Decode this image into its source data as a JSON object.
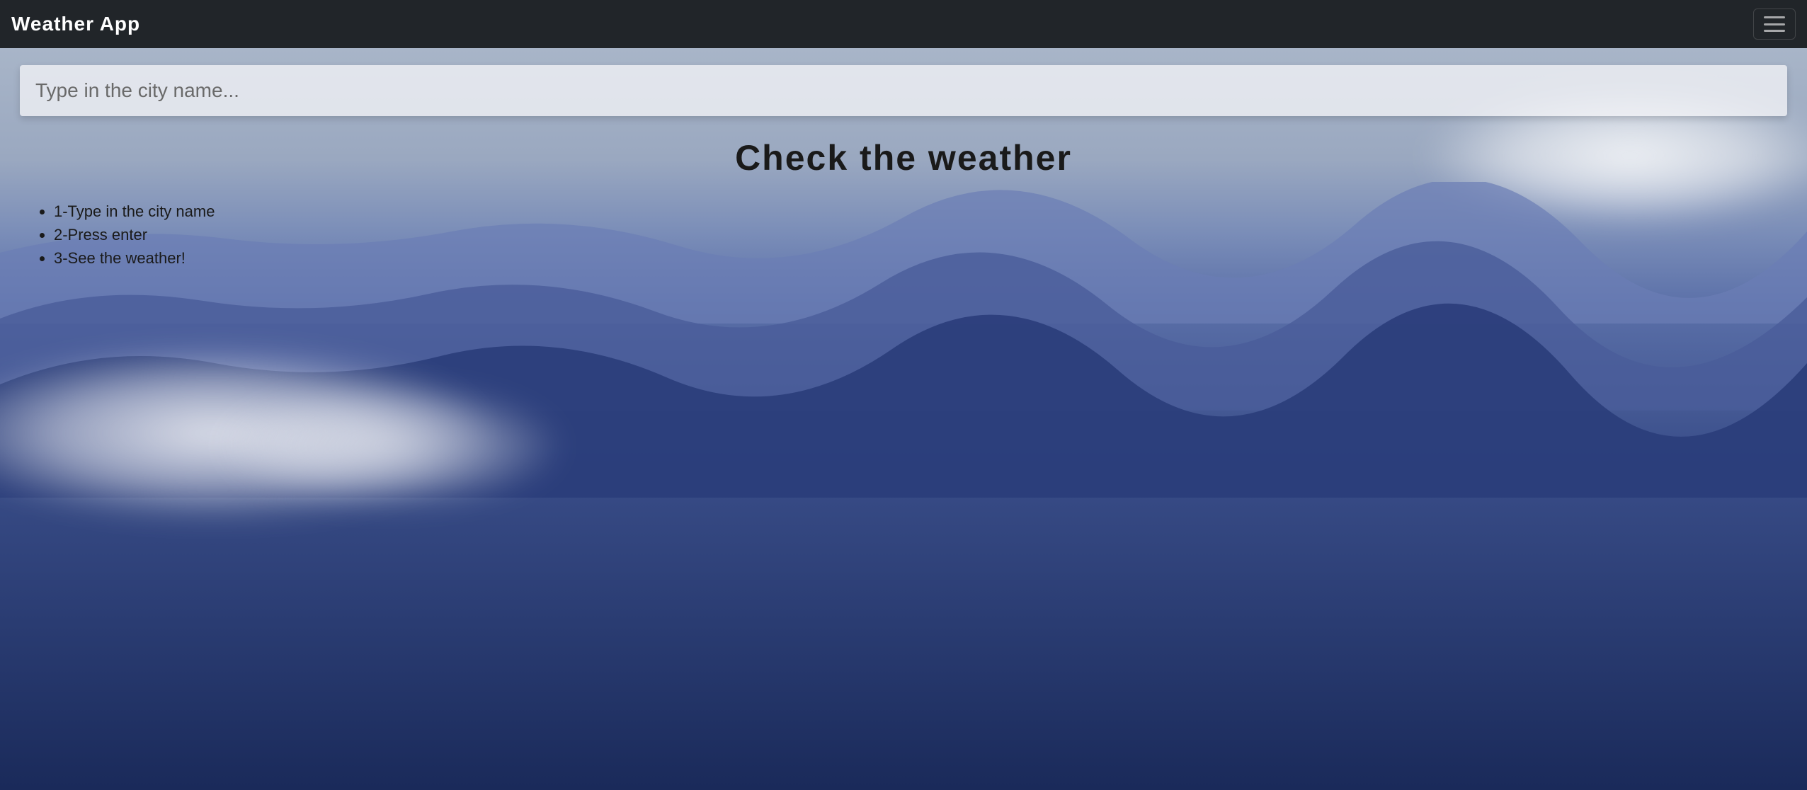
{
  "navbar": {
    "brand": "Weather App"
  },
  "search": {
    "placeholder": "Type in the city name...",
    "value": ""
  },
  "main": {
    "heading": "Check the weather",
    "instructions": [
      "1-Type in the city name",
      "2-Press enter",
      "3-See the weather!"
    ]
  }
}
